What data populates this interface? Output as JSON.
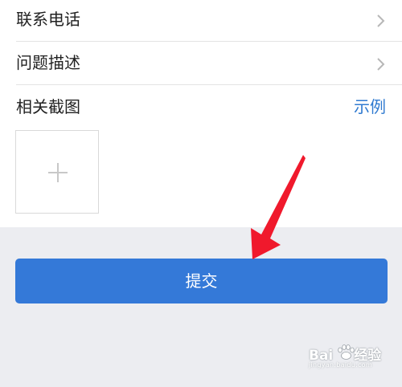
{
  "form": {
    "phone_label": "联系电话",
    "description_label": "问题描述",
    "screenshot_label": "相关截图",
    "example_link": "示例"
  },
  "actions": {
    "submit_label": "提交"
  },
  "watermark": {
    "brand_left": "Bai",
    "brand_right": "经验",
    "domain": "jingyan.baidu.com"
  },
  "colors": {
    "accent": "#3479d8",
    "link": "#2f7ad0",
    "arrow": "#f0192c",
    "background": "#ecedf1"
  },
  "icons": {
    "row_chevron": "chevron-right-icon",
    "upload": "plus-icon",
    "annotation": "red-arrow-icon"
  }
}
